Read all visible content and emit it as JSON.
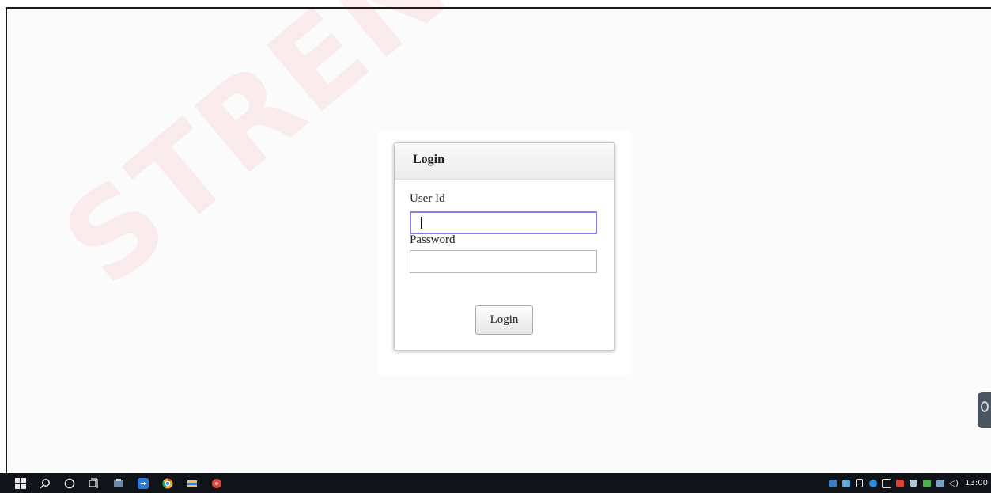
{
  "login": {
    "title": "Login",
    "user_label": "User Id",
    "user_value": "",
    "password_label": "Password",
    "password_value": "",
    "button_label": "Login"
  },
  "watermark": {
    "text": "STRENGTHERTR"
  },
  "taskbar": {
    "clock": "13:00",
    "left_icons": [
      "windows-start-icon",
      "search-icon",
      "cortana-icon",
      "task-view-icon",
      "app-icon",
      "teamviewer-icon",
      "chrome-icon",
      "file-explorer-icon",
      "app-red-icon"
    ],
    "tray_icons": [
      "network-icon",
      "app-tray-icon",
      "usb-icon",
      "hp-icon",
      "display-icon",
      "app-tray-icon-2",
      "shield-icon",
      "app-tray-icon-3",
      "battery-icon",
      "volume-icon"
    ]
  },
  "colors": {
    "focus_border": "#8e7de8",
    "taskbar_bg": "#101418",
    "watermark": "#e61e1e"
  }
}
